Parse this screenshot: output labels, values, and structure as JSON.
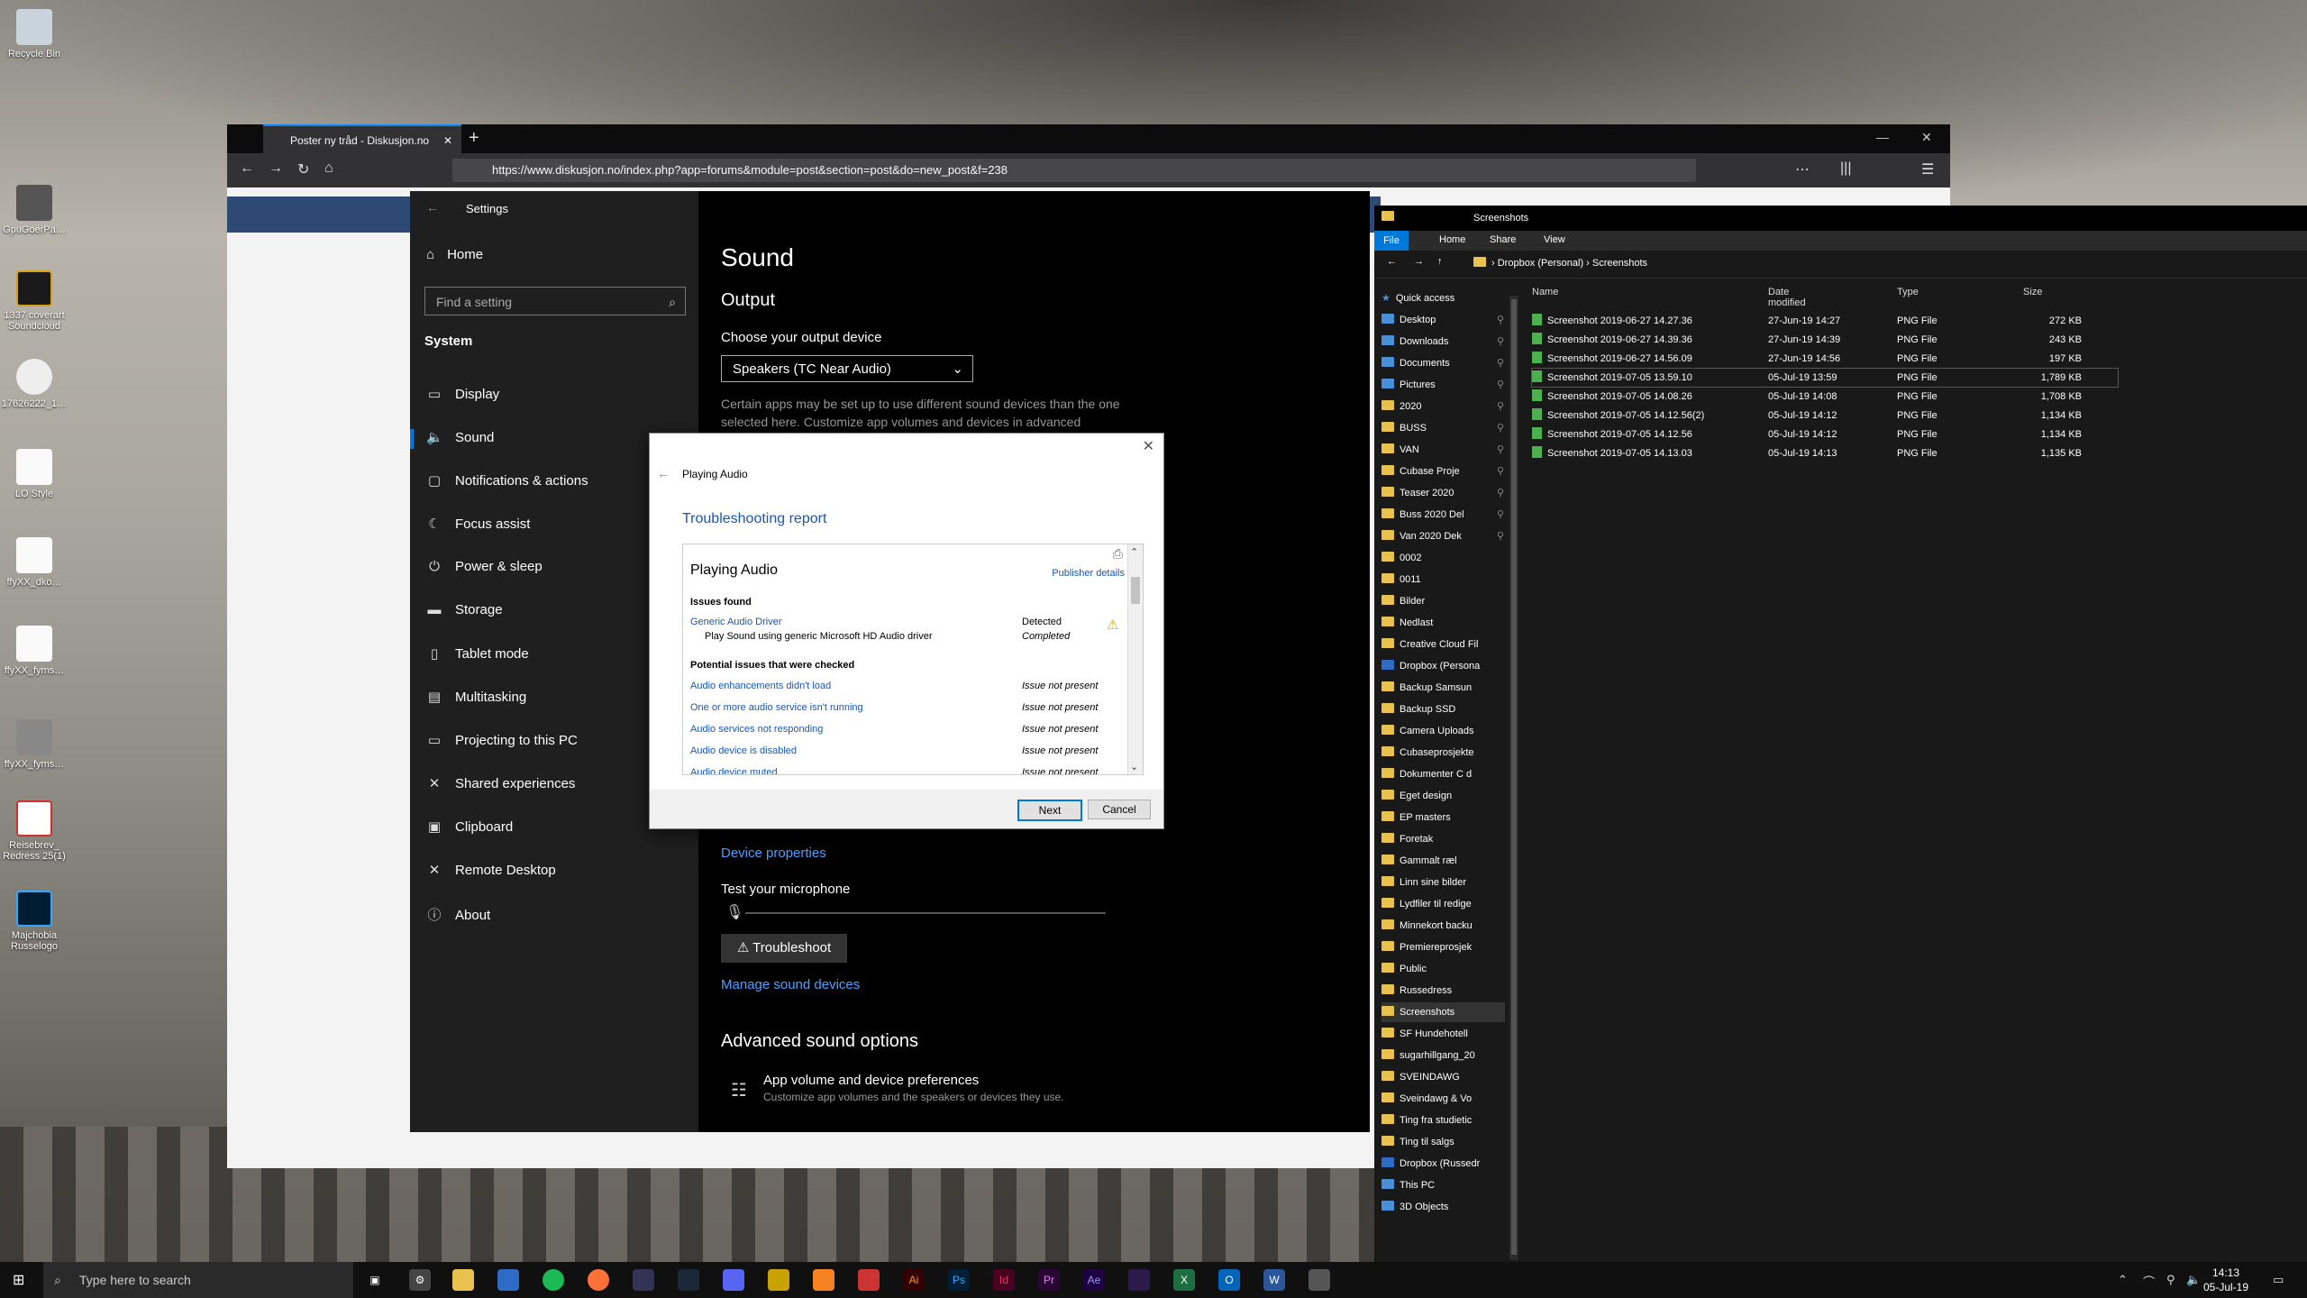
{
  "desktop": {
    "icons": [
      {
        "label": "Recycle Bin"
      },
      {
        "label": "GpuGoerPa…"
      },
      {
        "label": "1337 coverart Soundcloud"
      },
      {
        "label": "17626222_1…"
      },
      {
        "label": "LO Style"
      },
      {
        "label": "ffyXX_dko…"
      },
      {
        "label": "ffyXX_fyms…"
      },
      {
        "label": "ffyXX_fyms…"
      },
      {
        "label": "Reisebrev_ Redress 25(1)"
      },
      {
        "label": "Majchobia Russelogo"
      }
    ]
  },
  "browser": {
    "tab_title": "Poster ny tråd - Diskusjon.no",
    "url": "https://www.diskusjon.no/index.php?app=forums&module=post&section=post&do=new_post&f=238"
  },
  "settings": {
    "window_title": "Settings",
    "home": "Home",
    "search_placeholder": "Find a setting",
    "section": "System",
    "nav": [
      {
        "label": "Display",
        "icon": "display-icon"
      },
      {
        "label": "Sound",
        "icon": "speaker-icon"
      },
      {
        "label": "Notifications & actions",
        "icon": "notification-icon"
      },
      {
        "label": "Focus assist",
        "icon": "moon-icon"
      },
      {
        "label": "Power & sleep",
        "icon": "power-icon"
      },
      {
        "label": "Storage",
        "icon": "storage-icon"
      },
      {
        "label": "Tablet mode",
        "icon": "tablet-icon"
      },
      {
        "label": "Multitasking",
        "icon": "multitasking-icon"
      },
      {
        "label": "Projecting to this PC",
        "icon": "projector-icon"
      },
      {
        "label": "Shared experiences",
        "icon": "shared-icon"
      },
      {
        "label": "Clipboard",
        "icon": "clipboard-icon"
      },
      {
        "label": "Remote Desktop",
        "icon": "remote-icon"
      },
      {
        "label": "About",
        "icon": "info-icon"
      }
    ],
    "page_title": "Sound",
    "output_heading": "Output",
    "choose_output": "Choose your output device",
    "output_device": "Speakers (TC Near Audio)",
    "output_note": "Certain apps may be set up to use different sound devices than the one selected here. Customize app volumes and devices in advanced",
    "device_properties": "Device properties",
    "test_mic": "Test your microphone",
    "troubleshoot": "Troubleshoot",
    "manage_devices": "Manage sound devices",
    "advanced_heading": "Advanced sound options",
    "app_volume_title": "App volume and device preferences",
    "app_volume_desc": "Customize app volumes and the speakers or devices they use."
  },
  "dialog": {
    "title": "Playing Audio",
    "heading": "Troubleshooting report",
    "report_title": "Playing Audio",
    "publisher": "Publisher details",
    "issues_found": "Issues found",
    "found": [
      {
        "name": "Generic Audio Driver",
        "status": "Detected",
        "sub": "Play Sound using generic Microsoft HD Audio driver",
        "sub_status": "Completed"
      }
    ],
    "checked_heading": "Potential issues that were checked",
    "checked": [
      {
        "name": "Audio enhancements didn't load",
        "status": "Issue not present"
      },
      {
        "name": "One or more audio service isn't running",
        "status": "Issue not present"
      },
      {
        "name": "Audio services not responding",
        "status": "Issue not present"
      },
      {
        "name": "Audio device is disabled",
        "status": "Issue not present"
      },
      {
        "name": "Audio device muted",
        "status": "Issue not present"
      }
    ],
    "next": "Next",
    "cancel": "Cancel"
  },
  "explorer": {
    "title": "Screenshots",
    "ribbon": {
      "file": "File",
      "home": "Home",
      "share": "Share",
      "view": "View"
    },
    "breadcrumb": {
      "root": "Dropbox (Personal)",
      "current": "Screenshots"
    },
    "nav": [
      {
        "label": "Quick access",
        "type": "star"
      },
      {
        "label": "Desktop",
        "type": "blue",
        "pin": true
      },
      {
        "label": "Downloads",
        "type": "blue",
        "pin": true
      },
      {
        "label": "Documents",
        "type": "blue",
        "pin": true
      },
      {
        "label": "Pictures",
        "type": "blue",
        "pin": true
      },
      {
        "label": "2020",
        "type": "folder",
        "pin": true
      },
      {
        "label": "BUSS",
        "type": "folder",
        "pin": true
      },
      {
        "label": "VAN",
        "type": "folder",
        "pin": true
      },
      {
        "label": "Cubase Proje",
        "type": "folder",
        "pin": true
      },
      {
        "label": "Teaser 2020",
        "type": "folder",
        "pin": true
      },
      {
        "label": "Buss 2020 Del",
        "type": "folder",
        "pin": true
      },
      {
        "label": "Van 2020 Dek",
        "type": "folder",
        "pin": true
      },
      {
        "label": "0002",
        "type": "folder"
      },
      {
        "label": "0011",
        "type": "folder"
      },
      {
        "label": "Bilder",
        "type": "folder"
      },
      {
        "label": "Nedlast",
        "type": "folder"
      },
      {
        "label": "Creative Cloud Fil",
        "type": "folder"
      },
      {
        "label": "Dropbox (Persona",
        "type": "db"
      },
      {
        "label": "Backup Samsun",
        "type": "folder"
      },
      {
        "label": "Backup SSD",
        "type": "folder"
      },
      {
        "label": "Camera Uploads",
        "type": "folder"
      },
      {
        "label": "Cubaseprosjekte",
        "type": "folder"
      },
      {
        "label": "Dokumenter C d",
        "type": "folder"
      },
      {
        "label": "Eget design",
        "type": "folder"
      },
      {
        "label": "EP masters",
        "type": "folder"
      },
      {
        "label": "Foretak",
        "type": "folder"
      },
      {
        "label": "Gammalt ræl",
        "type": "folder"
      },
      {
        "label": "Linn sine bilder",
        "type": "folder"
      },
      {
        "label": "Lydfiler til redige",
        "type": "folder"
      },
      {
        "label": "Minnekort backu",
        "type": "folder"
      },
      {
        "label": "Premiereprosjek",
        "type": "folder"
      },
      {
        "label": "Public",
        "type": "folder"
      },
      {
        "label": "Russedress",
        "type": "folder"
      },
      {
        "label": "Screenshots",
        "type": "folder",
        "selected": true
      },
      {
        "label": "SF Hundehotell",
        "type": "folder"
      },
      {
        "label": "sugarhillgang_20",
        "type": "folder"
      },
      {
        "label": "SVEINDAWG",
        "type": "folder"
      },
      {
        "label": "Sveindawg & Vo",
        "type": "folder"
      },
      {
        "label": "Ting fra studietic",
        "type": "folder"
      },
      {
        "label": "Ting til salgs",
        "type": "folder"
      },
      {
        "label": "Dropbox (Russedr",
        "type": "db"
      },
      {
        "label": "This PC",
        "type": "blue"
      },
      {
        "label": "3D Objects",
        "type": "blue"
      }
    ],
    "columns": [
      "Name",
      "Date modified",
      "Type",
      "Size"
    ],
    "files": [
      [
        "Screenshot 2019-06-27 14.27.36",
        "27-Jun-19 14:27",
        "PNG File",
        "272 KB"
      ],
      [
        "Screenshot 2019-06-27 14.39.36",
        "27-Jun-19 14:39",
        "PNG File",
        "243 KB"
      ],
      [
        "Screenshot 2019-06-27 14.56.09",
        "27-Jun-19 14:56",
        "PNG File",
        "197 KB"
      ],
      [
        "Screenshot 2019-07-05 13.59.10",
        "05-Jul-19 13:59",
        "PNG File",
        "1,789 KB"
      ],
      [
        "Screenshot 2019-07-05 14.08.26",
        "05-Jul-19 14:08",
        "PNG File",
        "1,708 KB"
      ],
      [
        "Screenshot 2019-07-05 14.12.56(2)",
        "05-Jul-19 14:12",
        "PNG File",
        "1,134 KB"
      ],
      [
        "Screenshot 2019-07-05 14.12.56",
        "05-Jul-19 14:12",
        "PNG File",
        "1,134 KB"
      ],
      [
        "Screenshot 2019-07-05 14.13.03",
        "05-Jul-19 14:13",
        "PNG File",
        "1,135 KB"
      ]
    ]
  },
  "taskbar": {
    "search_placeholder": "Type here to search",
    "time": "14:13",
    "date": "05-Jul-19"
  }
}
